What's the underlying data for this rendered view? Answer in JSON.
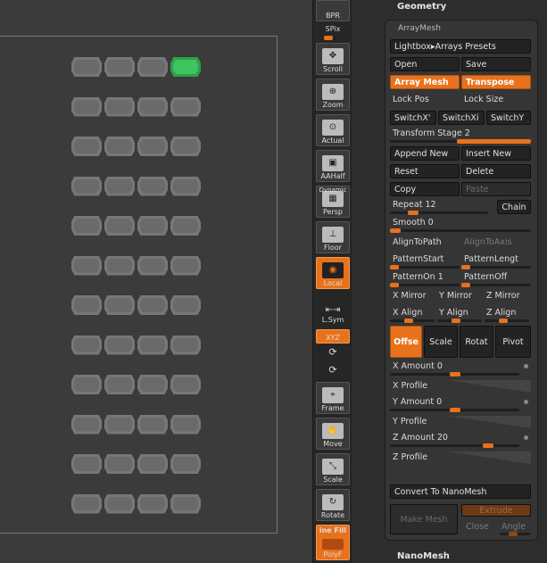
{
  "window": {
    "geometry_header": "Geometry",
    "nanomesh_header": "NanoMesh"
  },
  "shelf": {
    "bpr": "BPR",
    "spix": "SPix",
    "scroll": "Scroll",
    "zoom": "Zoom",
    "actual": "Actual",
    "aahalf": "AAHalf",
    "dynamic": "Dynamic",
    "persp": "Persp",
    "floor": "Floor",
    "local": "Local",
    "lsym": "L.Sym",
    "xyz": "XYZ",
    "frame": "Frame",
    "move": "Move",
    "scale": "Scale",
    "rotate": "Rotate",
    "linefill": "ine Fill",
    "polyf": "PolyF"
  },
  "arraymesh": {
    "title": "ArrayMesh",
    "lightbox": "Lightbox▸Arrays Presets",
    "open": "Open",
    "save": "Save",
    "array_mesh": "Array Mesh",
    "transpose": "Transpose",
    "lock_pos": "Lock Pos",
    "lock_size": "Lock Size",
    "switch1": "SwitchX'",
    "switch2": "SwitchXi",
    "switch3": "SwitchY",
    "transform_stage": "Transform Stage 2",
    "append_new": "Append New",
    "insert_new": "Insert New",
    "reset": "Reset",
    "delete": "Delete",
    "copy": "Copy",
    "paste": "Paste",
    "repeat": "Repeat 12",
    "chain": "Chain",
    "smooth": "Smooth 0",
    "align_to_path": "AlignToPath",
    "align_to_axis": "AlignToAxis",
    "pattern_start": "PatternStart",
    "pattern_length": "PatternLengt",
    "pattern_on": "PatternOn 1",
    "pattern_off": "PatternOff",
    "x_mirror": "X Mirror",
    "y_mirror": "Y Mirror",
    "z_mirror": "Z Mirror",
    "x_align": "X Align",
    "y_align": "Y Align",
    "z_align": "Z Align",
    "offset": "Offse",
    "scale": "Scale",
    "rotate": "Rotat",
    "pivot": "Pivot",
    "x_amount": "X Amount 0",
    "x_profile": "X Profile",
    "y_amount": "Y Amount 0",
    "y_profile": "Y Profile",
    "z_amount": "Z Amount 20",
    "z_profile": "Z Profile",
    "convert": "Convert To NanoMesh",
    "make_mesh": "Make Mesh",
    "extrude": "Extrude",
    "close": "Close",
    "angle": "Angle"
  },
  "sliders": {
    "transform_stage": 0.5,
    "repeat": 0.2,
    "smooth": 0.0,
    "x_amount": 0.5,
    "y_amount": 0.5,
    "z_amount": 0.6
  },
  "mesh": {
    "rows": 12,
    "segments_per_row": 4,
    "selected_row": 0,
    "selected_segment": 3
  },
  "colors": {
    "accent": "#e8721c",
    "selection": "#3ec45e"
  }
}
